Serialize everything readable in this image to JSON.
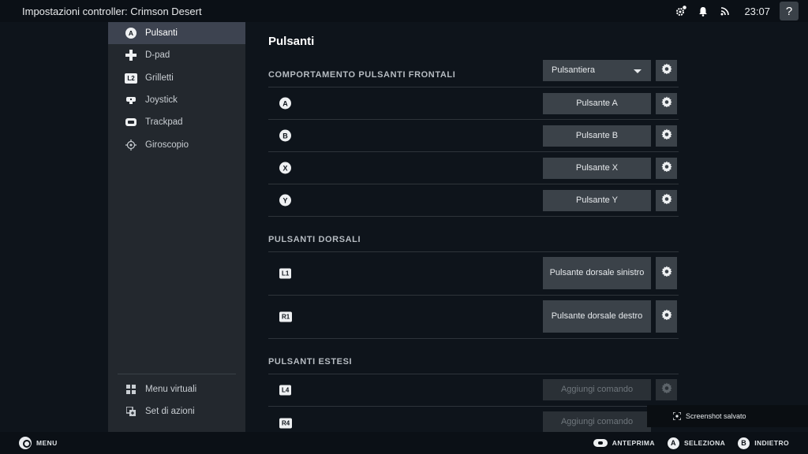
{
  "window": {
    "title": "Impostazioni controller: Crimson Desert",
    "time": "23:07",
    "help_label": "?"
  },
  "topbar_icons": [
    "settings-badge-icon",
    "bell-icon",
    "wifi-icon"
  ],
  "sidebar": {
    "items": [
      {
        "label": "Pulsanti",
        "icon": "face-button-a-icon",
        "glyph": "A",
        "active": true
      },
      {
        "label": "D-pad",
        "icon": "dpad-icon"
      },
      {
        "label": "Grilletti",
        "icon": "l2-trigger-icon",
        "glyph": "L2"
      },
      {
        "label": "Joystick",
        "icon": "joystick-icon"
      },
      {
        "label": "Trackpad",
        "icon": "trackpad-icon"
      },
      {
        "label": "Giroscopio",
        "icon": "gyro-icon"
      }
    ],
    "bottom_items": [
      {
        "label": "Menu virtuali",
        "icon": "grid-menu-icon"
      },
      {
        "label": "Set di azioni",
        "icon": "action-set-icon"
      }
    ]
  },
  "main": {
    "title": "Pulsanti",
    "sections": [
      {
        "header": "COMPORTAMENTO PULSANTI FRONTALI",
        "dropdown": "Pulsantiera",
        "rows": [
          {
            "glyph": "A",
            "action": "Pulsante A"
          },
          {
            "glyph": "B",
            "action": "Pulsante B"
          },
          {
            "glyph": "X",
            "action": "Pulsante X"
          },
          {
            "glyph": "Y",
            "action": "Pulsante Y"
          }
        ]
      },
      {
        "header": "PULSANTI DORSALI",
        "rows": [
          {
            "glyph": "L1",
            "action": "Pulsante dorsale sinistro"
          },
          {
            "glyph": "R1",
            "action": "Pulsante dorsale destro"
          }
        ]
      },
      {
        "header": "PULSANTI ESTESI",
        "rows": [
          {
            "glyph": "L4",
            "action": "Aggiungi comando",
            "disabled": true
          },
          {
            "glyph": "R4",
            "action": "Aggiungi comando",
            "disabled": true
          }
        ]
      }
    ]
  },
  "toast": {
    "text": "Screenshot salvato"
  },
  "bottombar": {
    "menu_label": "MENU",
    "hints": [
      {
        "label": "ANTEPRIMA",
        "icon": "preview-icon"
      },
      {
        "label": "SELEZIONA",
        "glyph": "A",
        "icon": "button-a-icon"
      },
      {
        "label": "INDIETRO",
        "glyph": "B",
        "icon": "button-b-icon"
      }
    ]
  },
  "colors": {
    "background": "#0e141b",
    "sidebar": "#23282e",
    "sidebar_active": "#3d4350",
    "button": "#3b4249",
    "button_disabled": "#2a3036"
  }
}
